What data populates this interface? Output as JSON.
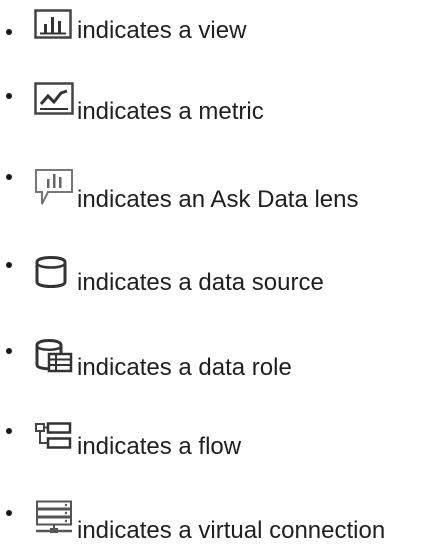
{
  "bullet_list": {
    "items": [
      {
        "icon": "view-icon",
        "label": "indicates a view"
      },
      {
        "icon": "metric-icon",
        "label": "indicates a metric"
      },
      {
        "icon": "ask-data-lens-icon",
        "label": "indicates an Ask Data lens"
      },
      {
        "icon": "data-source-icon",
        "label": "indicates a data source"
      },
      {
        "icon": "data-role-icon",
        "label": "indicates a data role"
      },
      {
        "icon": "flow-icon",
        "label": "indicates a flow"
      },
      {
        "icon": "virtual-connection-icon",
        "label": "indicates a virtual connection"
      }
    ]
  }
}
